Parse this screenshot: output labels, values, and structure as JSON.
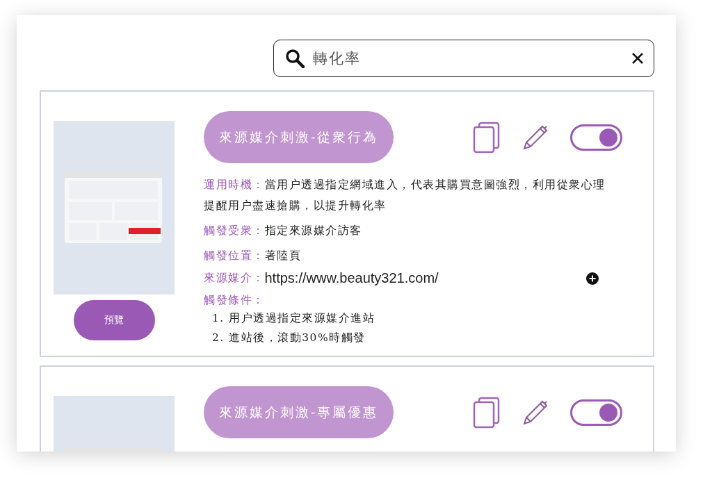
{
  "search": {
    "value": "轉化率"
  },
  "cards": [
    {
      "title": "來源媒介刺激-從衆行為",
      "enabled": true,
      "preview_button": "預覽",
      "details": [
        {
          "kind": "text",
          "label": "運用時機：",
          "value": "當用户透過指定網域進入，代表其購買意圖強烈，利用從衆心理提醒用户盡速搶購，以提升轉化率"
        },
        {
          "kind": "text",
          "label": "觸發受衆：",
          "value": "指定來源媒介訪客"
        },
        {
          "kind": "text",
          "label": "觸發位置：",
          "value": "著陸頁"
        },
        {
          "kind": "url",
          "label": "來源媒介：",
          "value": "https://www.beauty321.com/"
        },
        {
          "kind": "list",
          "label": "觸發條件：",
          "items": [
            "1. 用户透過指定來源媒介進站",
            "2. 進站後，滾動30%時觸發"
          ]
        }
      ]
    },
    {
      "title": "來源媒介刺激-專屬優惠",
      "enabled": true
    }
  ]
}
